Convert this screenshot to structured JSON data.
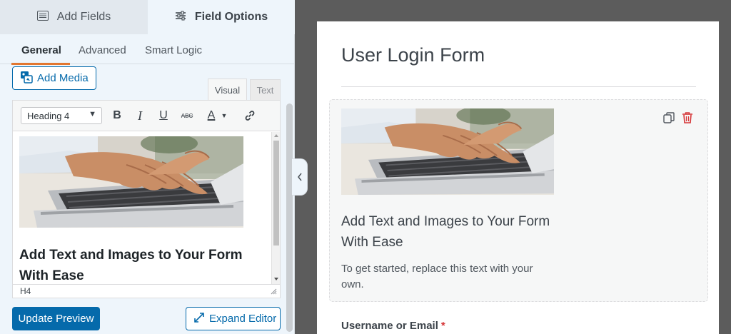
{
  "sidebar": {
    "tabs": [
      {
        "label": "Add Fields",
        "icon": "list-icon"
      },
      {
        "label": "Field Options",
        "icon": "sliders-icon"
      }
    ],
    "sub_tabs": [
      "General",
      "Advanced",
      "Smart Logic"
    ],
    "add_media_label": "Add Media",
    "editor_tabs": [
      "Visual",
      "Text"
    ],
    "format_select": "Heading 4",
    "toolbar_buttons": [
      "B",
      "I",
      "U",
      "ABC",
      "A"
    ],
    "content_heading": "Add Text and Images to Your Form With Ease",
    "status_path": "H4",
    "update_preview_label": "Update Preview",
    "expand_editor_label": "Expand Editor"
  },
  "preview": {
    "form_title": "User Login Form",
    "field_heading": "Add Text and Images to Your Form With Ease",
    "field_paragraph": "To get started, replace this text with your own.",
    "username_label": "Username or Email",
    "required_marker": "*"
  },
  "colors": {
    "accent": "#056aab",
    "active_underline": "#e27730",
    "danger": "#d63638"
  }
}
